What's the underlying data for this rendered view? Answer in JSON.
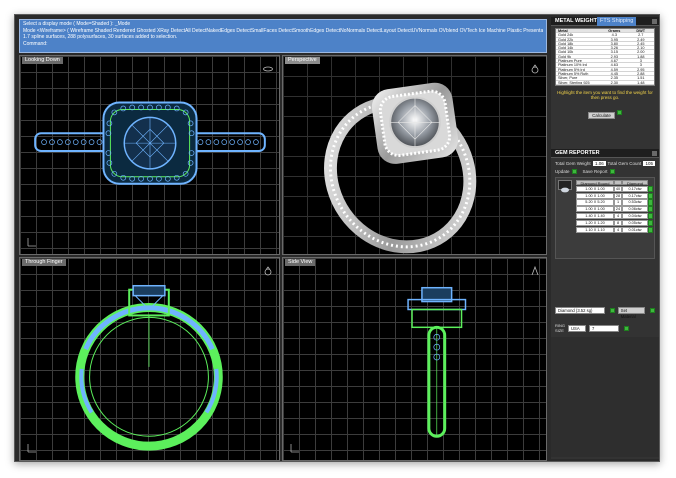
{
  "command": {
    "lines": [
      "Select a display mode ( Mode=Shaded ): _Mode",
      "Mode <Wireframe> ( Wireframe  Shaded  Rendered  Ghosted  XRay  DetectAll  DetectNakedEdges  DetectSmallFaces  DetectSmoothEdges  DetectNoNormals  DetectLayout  DetectUVNormals  OVblend  OVTech  Ice  Machine  Plastic  Presentation ):",
      "1.7 spline surfaces, 288 polysurfaces, 30 surfaces added to selection."
    ],
    "prompt": "Command:"
  },
  "viewports": {
    "top_left": {
      "title": "Looking Down"
    },
    "top_right": {
      "title": "Perspective"
    },
    "bottom_left": {
      "title": "Through Finger"
    },
    "bottom_right": {
      "title": "Side View"
    }
  },
  "metal_weights": {
    "title": "METAL WEIGHTS",
    "tab2": "FTS Shipping",
    "columns": [
      "Metal",
      "Grams",
      "DWT"
    ],
    "rows": [
      [
        "Gold 24k",
        "4.3",
        "2.7"
      ],
      [
        "Gold 22k",
        "3.95",
        "2.49"
      ],
      [
        "Gold 18k",
        "3.80",
        "2.45"
      ],
      [
        "Gold 14k",
        "3.26",
        "2.10"
      ],
      [
        "Gold 10k",
        "3.15",
        "2.00"
      ],
      [
        "Gold 9k",
        "2.93",
        "1.88"
      ],
      [
        "Platinum Pure",
        "4.67",
        "3"
      ],
      [
        "Platinum 10% Ird",
        "4.63",
        "3"
      ],
      [
        "Platinum 5% Ird",
        "4.59",
        "2.95"
      ],
      [
        "Platinum 5% Ruth",
        "4.45",
        "2.88"
      ],
      [
        "Silver, Pure",
        "2.35",
        "1.51"
      ],
      [
        "Silver, Sterling 925",
        "2.30",
        "1.48"
      ]
    ],
    "hint": "Highlight the item you want to find the weight for then press go.",
    "calculate_label": "Calculate"
  },
  "gem_reporter": {
    "title": "GEM REPORTER",
    "total_weight_label": "Total Gem Weight",
    "total_weight_value": "1.06",
    "total_count_label": "Total Gem Count",
    "total_count_value": "105",
    "update_label": "Update",
    "save_report_label": "Save Report",
    "col_headers": [
      "Diamond Round",
      "",
      "Diamond"
    ],
    "rows": [
      [
        "1.00 X 1.00",
        "40",
        "0.17ctw"
      ],
      [
        "1.00 X 1.00",
        "28",
        "0.17ctw"
      ],
      [
        "5.20 X 5.20",
        "1",
        "0.53ctw"
      ],
      [
        "1.00 X 1.00",
        "24",
        "0.06ctw"
      ],
      [
        "1.40 X 1.40",
        "4",
        "0.04ctw"
      ],
      [
        "1.20 X 1.20",
        "8",
        "0.05ctw"
      ],
      [
        "1.10 X 1.10",
        "4",
        "0.01ctw"
      ]
    ]
  },
  "material": {
    "select_value": "Diamond (3.52 sg)",
    "set_label": "Set Material"
  },
  "ring": {
    "label_top": "RING",
    "label_bottom": "SIZE",
    "region": "USA",
    "size": "7"
  },
  "colors": {
    "wire_blue": "#6fb4ff",
    "wire_green": "#5cf05c",
    "command_bg": "#4d82c8",
    "hint": "#f1d24a"
  }
}
